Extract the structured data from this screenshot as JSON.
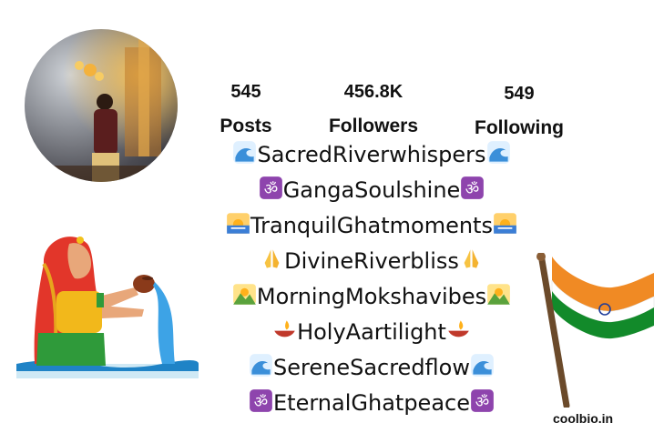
{
  "profile": {
    "stats": [
      {
        "value": "545",
        "label": "Posts"
      },
      {
        "value": "456.8K",
        "label": "Followers"
      },
      {
        "value": "549",
        "label": "Following"
      }
    ],
    "bio_lines": [
      {
        "text": "SacredRiverwhispers",
        "icon": "wave-icon"
      },
      {
        "text": "GangaSoulshine",
        "icon": "om-icon"
      },
      {
        "text": "TranquilGhatmoments",
        "icon": "sunrise-icon"
      },
      {
        "text": "DivineRiverbliss",
        "icon": "folded-hands-icon"
      },
      {
        "text": "MorningMokshavibes",
        "icon": "sunrise-mountains-icon"
      },
      {
        "text": "HolyAartilight",
        "icon": "diya-lamp-icon"
      },
      {
        "text": "SereneSacredflow",
        "icon": "wave-icon"
      },
      {
        "text": "EternalGhatpeace",
        "icon": "om-icon"
      }
    ]
  },
  "watermark": "coolbio.in",
  "colors": {
    "wave": "#3b8fd9",
    "om": "#8e44ad",
    "saffron": "#f08a24",
    "india_green": "#128a2a"
  }
}
